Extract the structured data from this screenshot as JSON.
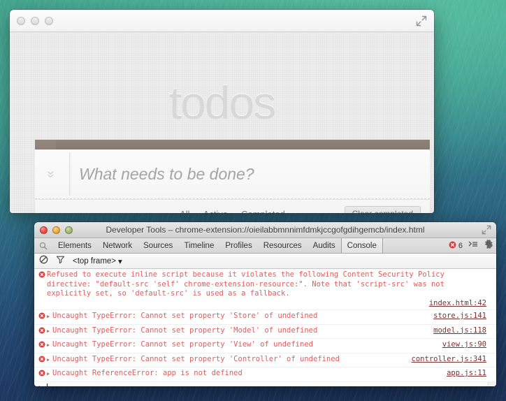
{
  "desktop": {
    "wallpaper_top_color": "#3fa083",
    "wallpaper_bottom_color": "#1b3358"
  },
  "browser_window": {
    "traffic_lights": [
      "close",
      "minimize",
      "zoom"
    ],
    "expand_icon": "expand-arrows-icon",
    "todoapp": {
      "title": "todos",
      "toggle_all_icon": "chevron-double-icon",
      "new_todo_placeholder": "What needs to be done?",
      "new_todo_value": "",
      "filters": [
        {
          "label": "All",
          "selected": false
        },
        {
          "label": "Active",
          "selected": false
        },
        {
          "label": "Completed",
          "selected": false
        }
      ],
      "clear_completed_label": "Clear completed"
    }
  },
  "devtools_window": {
    "title": "Developer Tools – chrome-extension://oieilabbmnnimfdmkjccgofgdihgemcb/index.html",
    "expand_icon": "expand-arrows-icon",
    "traffic_lights": [
      {
        "name": "close",
        "color": "#f25550"
      },
      {
        "name": "minimize",
        "color": "#f7b33f"
      },
      {
        "name": "zoom",
        "color": "#a9bf7e"
      }
    ],
    "toolbar": {
      "search_icon": "search-icon",
      "tabs": [
        {
          "label": "Elements",
          "active": false
        },
        {
          "label": "Network",
          "active": false
        },
        {
          "label": "Sources",
          "active": false
        },
        {
          "label": "Timeline",
          "active": false
        },
        {
          "label": "Profiles",
          "active": false
        },
        {
          "label": "Resources",
          "active": false
        },
        {
          "label": "Audits",
          "active": false
        },
        {
          "label": "Console",
          "active": true
        }
      ],
      "error_badge": {
        "icon": "error-circle-icon",
        "count": "6",
        "color": "#e03a3a"
      },
      "drawer_icon": "console-drawer-icon",
      "settings_icon": "gear-icon"
    },
    "filterbar": {
      "clear_console_icon": "clear-console-icon",
      "filter_icon": "funnel-filter-icon",
      "context_label": "<top frame>",
      "context_caret": "▾"
    },
    "console": {
      "messages": [
        {
          "level": "error",
          "icon": "error-circle-icon",
          "expandable": false,
          "text": "Refused to execute inline script because it violates the following Content Security Policy directive: \"default-src 'self' chrome-extension-resource:\". Note that 'script-src' was not explicitly set, so 'default-src' is used as a fallback.",
          "source": "index.html:42",
          "multiline": true
        },
        {
          "level": "error",
          "icon": "error-circle-icon",
          "expandable": true,
          "disclosure": "▶",
          "text": "Uncaught TypeError: Cannot set property 'Store' of undefined",
          "source": "store.js:141",
          "multiline": false
        },
        {
          "level": "error",
          "icon": "error-circle-icon",
          "expandable": true,
          "disclosure": "▶",
          "text": "Uncaught TypeError: Cannot set property 'Model' of undefined",
          "source": "model.js:118",
          "multiline": false
        },
        {
          "level": "error",
          "icon": "error-circle-icon",
          "expandable": true,
          "disclosure": "▶",
          "text": "Uncaught TypeError: Cannot set property 'View' of undefined",
          "source": "view.js:90",
          "multiline": false
        },
        {
          "level": "error",
          "icon": "error-circle-icon",
          "expandable": true,
          "disclosure": "▶",
          "text": "Uncaught TypeError: Cannot set property 'Controller' of undefined",
          "source": "controller.js:341",
          "multiline": false
        },
        {
          "level": "error",
          "icon": "error-circle-icon",
          "expandable": true,
          "disclosure": "▶",
          "text": "Uncaught ReferenceError: app is not defined",
          "source": "app.js:11",
          "multiline": false
        }
      ],
      "prompt_chevron": ">",
      "prompt_value": "",
      "error_text_color": "#e55c5c"
    }
  }
}
